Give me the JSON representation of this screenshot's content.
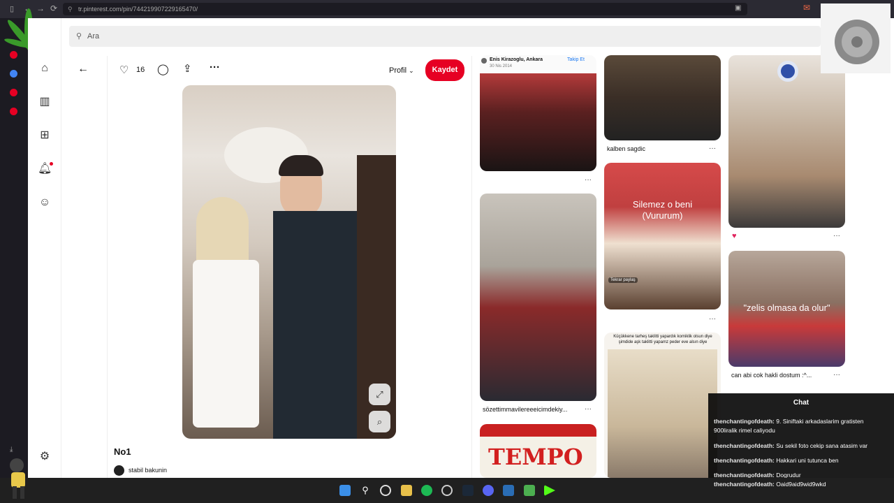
{
  "browser": {
    "url": "tr.pinterest.com/pin/744219907229165470/"
  },
  "search": {
    "placeholder": "Ara"
  },
  "toolbar": {
    "like_count": "16",
    "profile_label": "Profil",
    "save_label": "Kaydet"
  },
  "pin": {
    "title": "No1",
    "author": "stabil bakunin"
  },
  "grid": {
    "col1": {
      "tile1_header": "Enis Kirazoglu, Ankara",
      "tile1_date": "30 Nis 2014",
      "tile1_follow": "Takip Et",
      "tile2_caption": "sözettimmavilereeeicimdekiy...",
      "tile3_text": "TEMPO"
    },
    "col2": {
      "tile1_caption": "kalben sagdic",
      "tile2_overlay_line1": "Silemez o beni",
      "tile2_overlay_line2": "(Vururum)",
      "tile2_tag": "Tekrar paylaş",
      "tile3_header": "Küçükkene tarheş taklitti yapardık komiklik olsun diye şimdide aşk taklitti yapamz peder eve alsın diye"
    },
    "col3": {
      "tile2_overlay": "\"zelis olmasa da olur\"",
      "tile2_caption": "can abi cok hakli dostum :^..."
    }
  },
  "chat": {
    "title": "Chat",
    "messages": [
      {
        "user": "thenchantingofdeath:",
        "text": "9. Siniftaki arkadaslarim gratisten 900liralik rimel caliyodu"
      },
      {
        "user": "thenchantingofdeath:",
        "text": "Su sekil foto cekip sana atasim var"
      },
      {
        "user": "thenchantingofdeath:",
        "text": "Hakkari uni tutunca ben"
      },
      {
        "user": "thenchantingofdeath:",
        "text": "Dogrudur"
      },
      {
        "user": "thenchantingofdeath:",
        "text": "Oaid9aid9wid9wkd"
      }
    ]
  },
  "colors": {
    "accent": "#e60023",
    "taskbar": "#202020",
    "chat_bg": "#0a0a0a"
  },
  "icons": [
    "home-icon",
    "explore-icon",
    "create-icon",
    "bell-icon",
    "chat-icon",
    "settings-icon",
    "back-icon",
    "heart-icon",
    "comment-icon",
    "share-icon",
    "more-icon",
    "expand-icon",
    "visual-search-icon",
    "search-icon"
  ]
}
